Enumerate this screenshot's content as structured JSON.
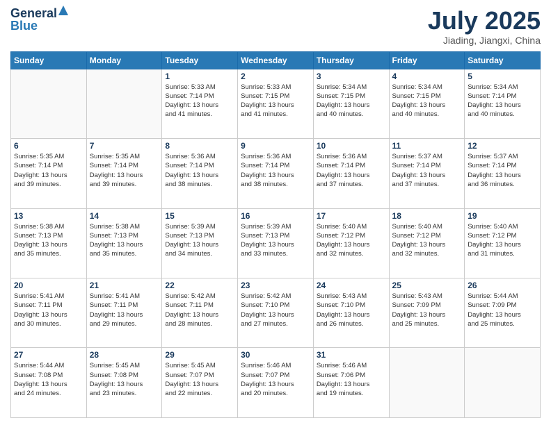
{
  "logo": {
    "general": "General",
    "blue": "Blue"
  },
  "header": {
    "month": "July 2025",
    "location": "Jiading, Jiangxi, China"
  },
  "weekdays": [
    "Sunday",
    "Monday",
    "Tuesday",
    "Wednesday",
    "Thursday",
    "Friday",
    "Saturday"
  ],
  "weeks": [
    [
      {
        "day": "",
        "info": ""
      },
      {
        "day": "",
        "info": ""
      },
      {
        "day": "1",
        "info": "Sunrise: 5:33 AM\nSunset: 7:14 PM\nDaylight: 13 hours\nand 41 minutes."
      },
      {
        "day": "2",
        "info": "Sunrise: 5:33 AM\nSunset: 7:15 PM\nDaylight: 13 hours\nand 41 minutes."
      },
      {
        "day": "3",
        "info": "Sunrise: 5:34 AM\nSunset: 7:15 PM\nDaylight: 13 hours\nand 40 minutes."
      },
      {
        "day": "4",
        "info": "Sunrise: 5:34 AM\nSunset: 7:15 PM\nDaylight: 13 hours\nand 40 minutes."
      },
      {
        "day": "5",
        "info": "Sunrise: 5:34 AM\nSunset: 7:14 PM\nDaylight: 13 hours\nand 40 minutes."
      }
    ],
    [
      {
        "day": "6",
        "info": "Sunrise: 5:35 AM\nSunset: 7:14 PM\nDaylight: 13 hours\nand 39 minutes."
      },
      {
        "day": "7",
        "info": "Sunrise: 5:35 AM\nSunset: 7:14 PM\nDaylight: 13 hours\nand 39 minutes."
      },
      {
        "day": "8",
        "info": "Sunrise: 5:36 AM\nSunset: 7:14 PM\nDaylight: 13 hours\nand 38 minutes."
      },
      {
        "day": "9",
        "info": "Sunrise: 5:36 AM\nSunset: 7:14 PM\nDaylight: 13 hours\nand 38 minutes."
      },
      {
        "day": "10",
        "info": "Sunrise: 5:36 AM\nSunset: 7:14 PM\nDaylight: 13 hours\nand 37 minutes."
      },
      {
        "day": "11",
        "info": "Sunrise: 5:37 AM\nSunset: 7:14 PM\nDaylight: 13 hours\nand 37 minutes."
      },
      {
        "day": "12",
        "info": "Sunrise: 5:37 AM\nSunset: 7:14 PM\nDaylight: 13 hours\nand 36 minutes."
      }
    ],
    [
      {
        "day": "13",
        "info": "Sunrise: 5:38 AM\nSunset: 7:13 PM\nDaylight: 13 hours\nand 35 minutes."
      },
      {
        "day": "14",
        "info": "Sunrise: 5:38 AM\nSunset: 7:13 PM\nDaylight: 13 hours\nand 35 minutes."
      },
      {
        "day": "15",
        "info": "Sunrise: 5:39 AM\nSunset: 7:13 PM\nDaylight: 13 hours\nand 34 minutes."
      },
      {
        "day": "16",
        "info": "Sunrise: 5:39 AM\nSunset: 7:13 PM\nDaylight: 13 hours\nand 33 minutes."
      },
      {
        "day": "17",
        "info": "Sunrise: 5:40 AM\nSunset: 7:12 PM\nDaylight: 13 hours\nand 32 minutes."
      },
      {
        "day": "18",
        "info": "Sunrise: 5:40 AM\nSunset: 7:12 PM\nDaylight: 13 hours\nand 32 minutes."
      },
      {
        "day": "19",
        "info": "Sunrise: 5:40 AM\nSunset: 7:12 PM\nDaylight: 13 hours\nand 31 minutes."
      }
    ],
    [
      {
        "day": "20",
        "info": "Sunrise: 5:41 AM\nSunset: 7:11 PM\nDaylight: 13 hours\nand 30 minutes."
      },
      {
        "day": "21",
        "info": "Sunrise: 5:41 AM\nSunset: 7:11 PM\nDaylight: 13 hours\nand 29 minutes."
      },
      {
        "day": "22",
        "info": "Sunrise: 5:42 AM\nSunset: 7:11 PM\nDaylight: 13 hours\nand 28 minutes."
      },
      {
        "day": "23",
        "info": "Sunrise: 5:42 AM\nSunset: 7:10 PM\nDaylight: 13 hours\nand 27 minutes."
      },
      {
        "day": "24",
        "info": "Sunrise: 5:43 AM\nSunset: 7:10 PM\nDaylight: 13 hours\nand 26 minutes."
      },
      {
        "day": "25",
        "info": "Sunrise: 5:43 AM\nSunset: 7:09 PM\nDaylight: 13 hours\nand 25 minutes."
      },
      {
        "day": "26",
        "info": "Sunrise: 5:44 AM\nSunset: 7:09 PM\nDaylight: 13 hours\nand 25 minutes."
      }
    ],
    [
      {
        "day": "27",
        "info": "Sunrise: 5:44 AM\nSunset: 7:08 PM\nDaylight: 13 hours\nand 24 minutes."
      },
      {
        "day": "28",
        "info": "Sunrise: 5:45 AM\nSunset: 7:08 PM\nDaylight: 13 hours\nand 23 minutes."
      },
      {
        "day": "29",
        "info": "Sunrise: 5:45 AM\nSunset: 7:07 PM\nDaylight: 13 hours\nand 22 minutes."
      },
      {
        "day": "30",
        "info": "Sunrise: 5:46 AM\nSunset: 7:07 PM\nDaylight: 13 hours\nand 20 minutes."
      },
      {
        "day": "31",
        "info": "Sunrise: 5:46 AM\nSunset: 7:06 PM\nDaylight: 13 hours\nand 19 minutes."
      },
      {
        "day": "",
        "info": ""
      },
      {
        "day": "",
        "info": ""
      }
    ]
  ]
}
